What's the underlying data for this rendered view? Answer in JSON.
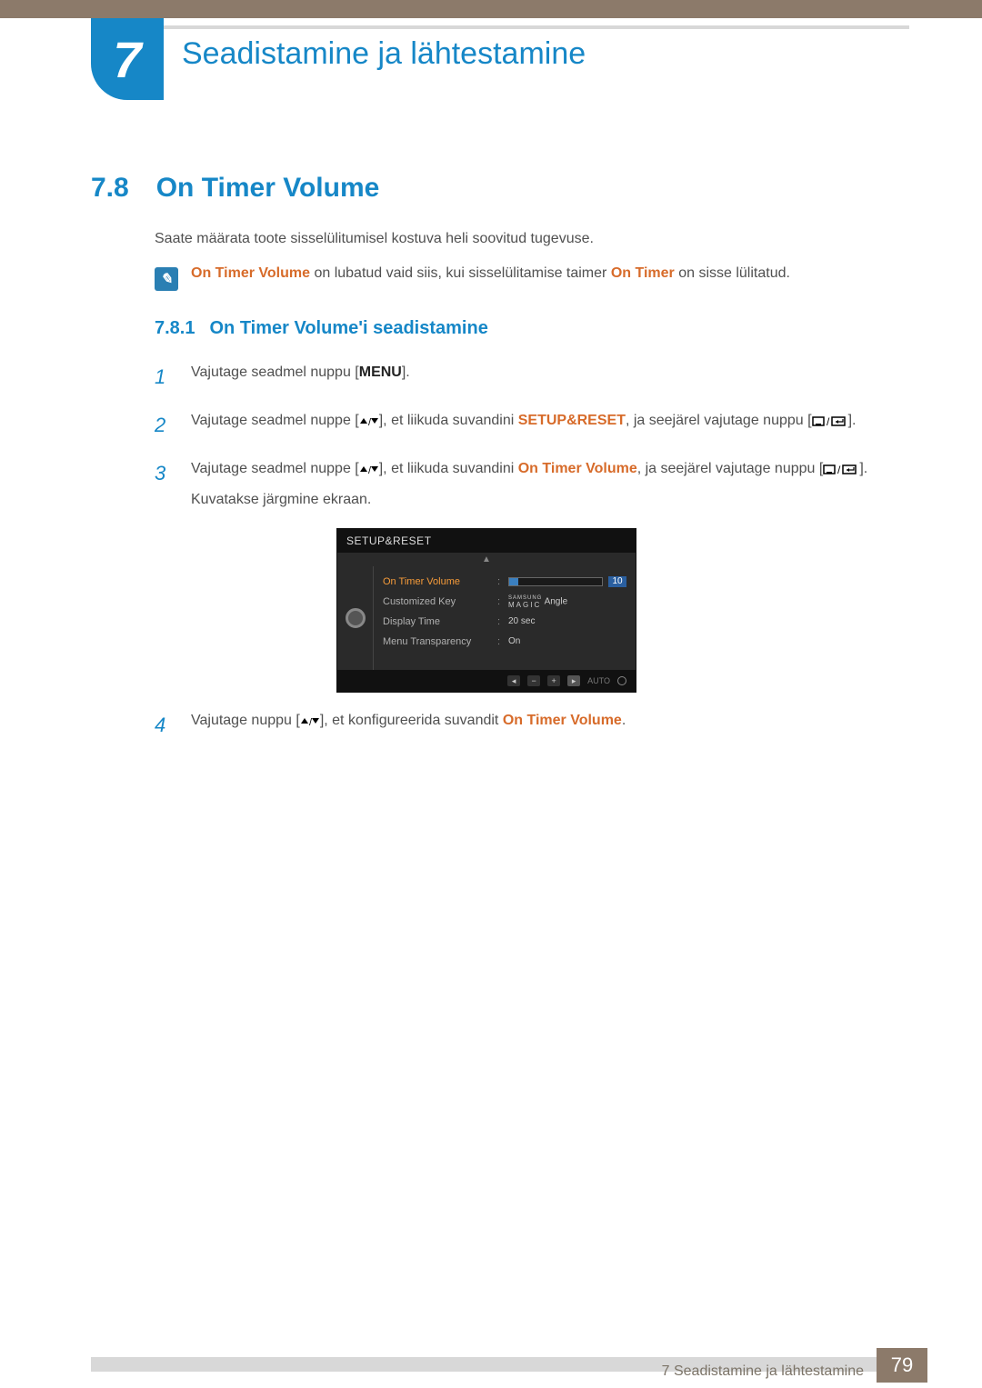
{
  "chapter": {
    "number": "7",
    "title": "Seadistamine ja lähtestamine"
  },
  "section": {
    "number": "7.8",
    "title": "On Timer Volume"
  },
  "intro": "Saate määrata toote sisselülitumisel kostuva heli soovitud tugevuse.",
  "note": {
    "t1": "On Timer Volume",
    "t2": " on lubatud vaid siis, kui sisselülitamise taimer ",
    "t3": "On Timer",
    "t4": " on sisse lülitatud."
  },
  "subsection": {
    "number": "7.8.1",
    "title": "On Timer Volume'i seadistamine"
  },
  "steps": {
    "s1": {
      "n": "1",
      "a": "Vajutage seadmel nuppu [",
      "menu": "MENU",
      "b": "]."
    },
    "s2": {
      "n": "2",
      "a": "Vajutage seadmel nuppe [",
      "b": "], et liikuda suvandini ",
      "hl": "SETUP&RESET",
      "c": ", ja seejärel vajutage nuppu [",
      "d": "]."
    },
    "s3": {
      "n": "3",
      "a": "Vajutage seadmel nuppe [",
      "b": "], et liikuda suvandini ",
      "hl": "On Timer Volume",
      "c": ", ja seejärel vajutage nuppu [",
      "d": "].",
      "after": "Kuvatakse järgmine ekraan."
    },
    "s4": {
      "n": "4",
      "a": "Vajutage nuppu [",
      "b": "], et konfigureerida suvandit ",
      "hl": "On Timer Volume",
      "c": "."
    }
  },
  "osd": {
    "title": "SETUP&RESET",
    "rows": [
      {
        "label": "On Timer  Volume",
        "selected": true,
        "type": "bar",
        "value": "10",
        "fill_pct": 10
      },
      {
        "label": "Customized Key",
        "value": "Angle",
        "prefix_top": "SAMSUNG",
        "prefix_bottom": "MAGIC"
      },
      {
        "label": "Display Time",
        "value": "20 sec"
      },
      {
        "label": "Menu Transparency",
        "value": "On"
      }
    ],
    "footer_buttons": [
      "◂",
      "−",
      "+",
      "▸"
    ],
    "footer_auto": "AUTO"
  },
  "footer": {
    "text": "7 Seadistamine ja lähtestamine",
    "page": "79"
  }
}
